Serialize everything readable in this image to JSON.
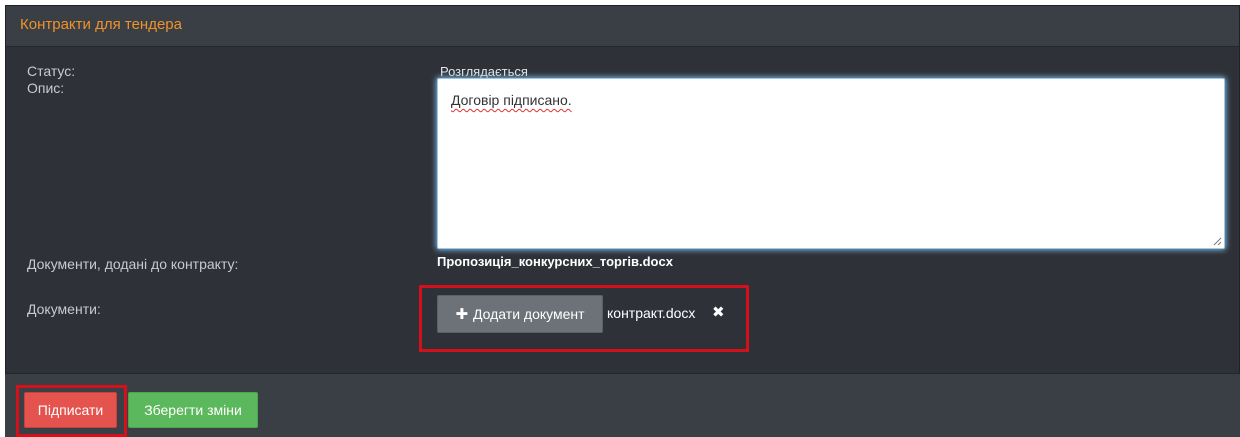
{
  "panel": {
    "title": "Контракти для тендера",
    "accent_color": "#f0922b"
  },
  "form": {
    "status_label": "Статус:",
    "status_value": "Розглядається",
    "description_label": "Опис:",
    "description_value": "Договір підписано.",
    "attached_docs_label": "Документи, додані до контракту:",
    "attached_doc_name": "Пропозиція_конкурсних_торгів.docx",
    "documents_label": "Документи:",
    "add_document_label": "Додати документ",
    "add_icon": "plus-icon",
    "uploaded_file_name": "контракт.docx",
    "remove_icon": "close-icon"
  },
  "footer": {
    "sign_label": "Підписати",
    "sign_color": "#e5534f",
    "save_label": "Зберегти зміни",
    "save_color": "#5cb85c"
  },
  "annotations": {
    "highlight_color": "#d4101a"
  }
}
